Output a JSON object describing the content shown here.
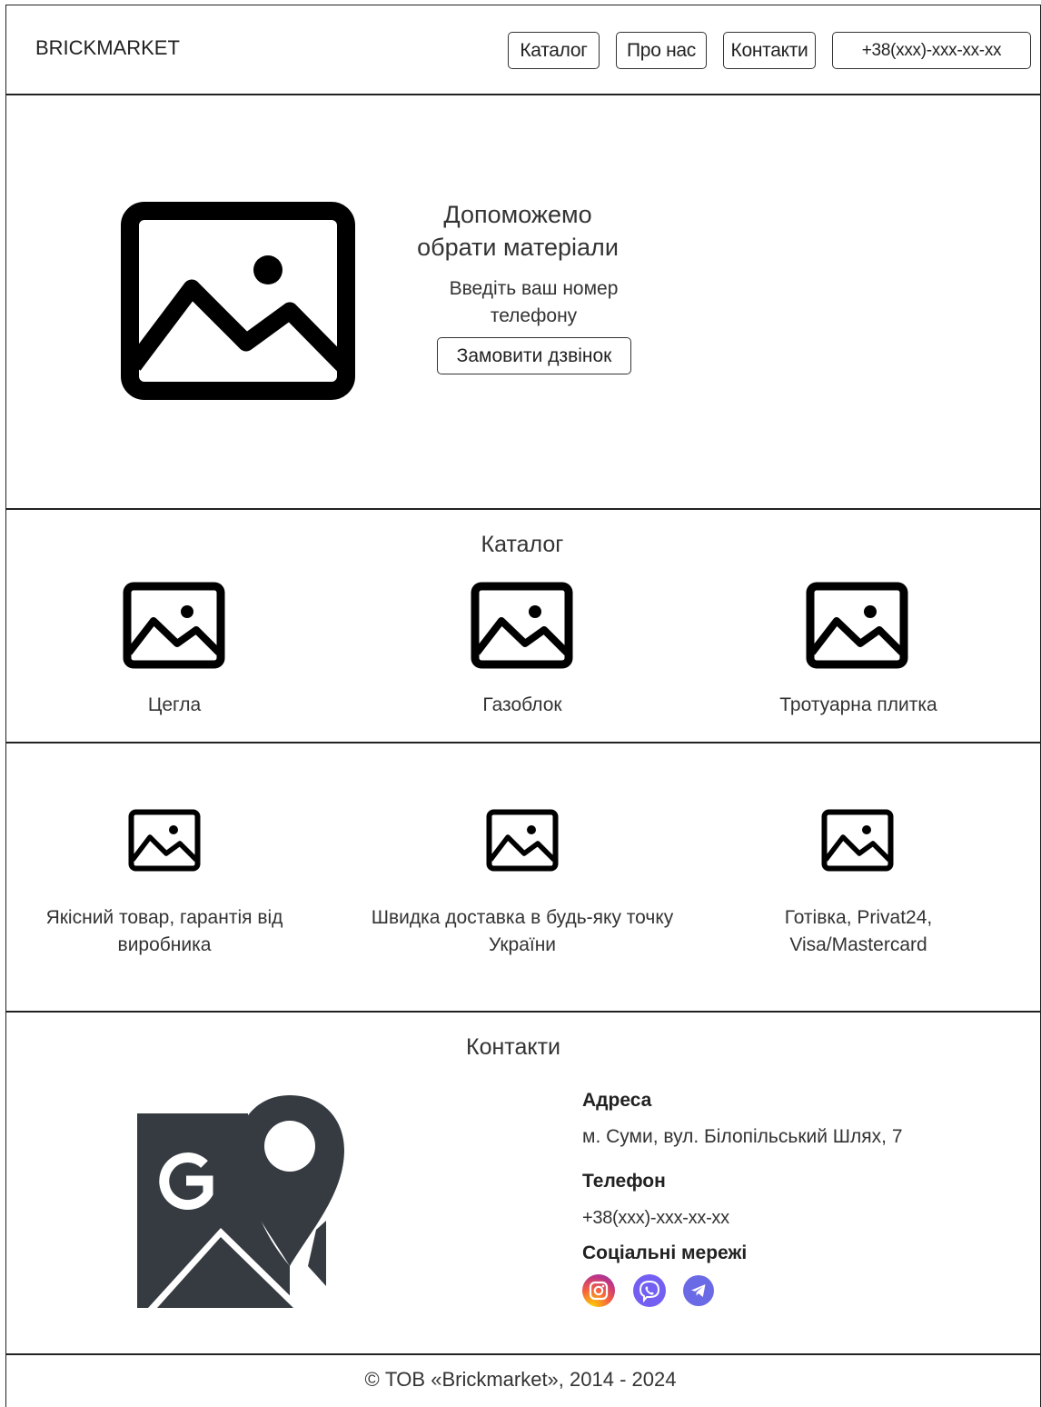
{
  "header": {
    "logo": "BRICKMARKET",
    "nav": [
      "Каталог",
      "Про нас",
      "Контакти"
    ],
    "phone": "+38(xxx)-xxx-xx-xx"
  },
  "hero": {
    "title": "Допоможемо обрати матеріали",
    "subtitle": "Введіть ваш номер телефону",
    "button": "Замовити дзвінок",
    "image_icon": "image-placeholder-icon"
  },
  "catalog": {
    "title": "Каталог",
    "items": [
      {
        "label": "Цегла",
        "icon": "image-placeholder-icon"
      },
      {
        "label": "Газоблок",
        "icon": "image-placeholder-icon"
      },
      {
        "label": "Тротуарна плитка",
        "icon": "image-placeholder-icon"
      }
    ]
  },
  "features": {
    "items": [
      {
        "label": "Якісний товар, гарантія від виробника",
        "icon": "image-placeholder-icon"
      },
      {
        "label": "Швидка доставка в будь-яку точку України",
        "icon": "image-placeholder-icon"
      },
      {
        "label": "Готівка, Privat24, Visa/Mastercard",
        "icon": "image-placeholder-icon"
      }
    ]
  },
  "contacts": {
    "title": "Контакти",
    "map_icon": "google-maps-icon",
    "address_label": "Адреса",
    "address": "м. Суми, вул. Білопільський Шлях, 7",
    "phone_label": "Телефон",
    "phone": "+38(xxx)-xxx-xx-xx",
    "social_label": "Соціальні мережі",
    "social": [
      {
        "icon": "instagram-icon",
        "color": "#e1306c"
      },
      {
        "icon": "viber-icon",
        "color": "#7360f2"
      },
      {
        "icon": "telegram-icon",
        "color": "#6a6ae6"
      }
    ]
  },
  "footer": {
    "copyright": "© ТОВ «Brickmarket», 2014 - 2024"
  }
}
